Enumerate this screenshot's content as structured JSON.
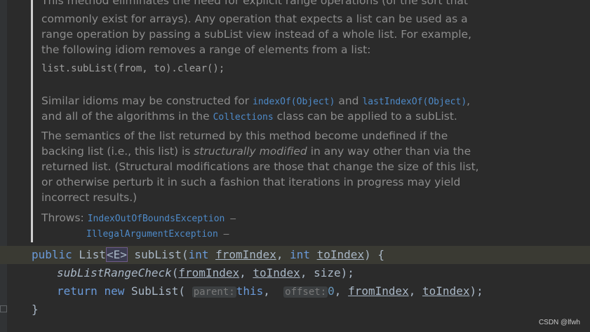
{
  "doc": {
    "line0": "This method eliminates the need for explicit range operations (of the sort that",
    "line1": "commonly exist for arrays). Any operation that expects a list can be used as a",
    "line2": "range operation by passing a subList view instead of a whole list. For example,",
    "line3": "the following idiom removes a range of elements from a list:",
    "code_example": "list.subList(from, to).clear();",
    "p2_a": "Similar idioms may be constructed for ",
    "p2_link1": "indexOf(Object)",
    "p2_b": " and ",
    "p2_link2": "lastIndexOf(Object)",
    "p2_c": ",",
    "p2_line2_a": "and all of the algorithms in the ",
    "p2_link3": "Collections",
    "p2_line2_b": " class can be applied to a subList.",
    "p3_line1": "The semantics of the list returned by this method become undefined if the",
    "p3_line2_a": "backing list (i.e., this list) is ",
    "p3_line2_em": "structurally modified",
    "p3_line2_b": " in any way other than via the",
    "p3_line3": "returned list. (Structural modifications are those that change the size of this list,",
    "p3_line4": "or otherwise perturb it in such a fashion that iterations in progress may yield",
    "p3_line5": "incorrect results.)",
    "throws_label": "Throws: ",
    "throws1": "IndexOutOfBoundsException",
    "throws1_dash": " –",
    "throws2": "IllegalArgumentException",
    "throws2_dash": " –"
  },
  "code": {
    "l1_public": "public",
    "l1_type": " List",
    "l1_generic": "<E>",
    "l1_method": " subList",
    "l1_open": "(",
    "l1_int1": "int",
    "l1_p1": "fromIndex",
    "l1_comma": ", ",
    "l1_int2": "int",
    "l1_p2": "toIndex",
    "l1_close": ") {",
    "l2_call": "subListRangeCheck",
    "l2_open": "(",
    "l2_a1": "fromIndex",
    "l2_c1": ", ",
    "l2_a2": "toIndex",
    "l2_c2": ", ",
    "l2_a3": "size",
    "l2_close": ");",
    "l3_return": "return",
    "l3_new": "new",
    "l3_type": "SubList(",
    "l3_hint1": "parent:",
    "l3_this": "this",
    "l3_c1": ", ",
    "l3_hint2": "offset:",
    "l3_zero": "0",
    "l3_c2": ", ",
    "l3_a1": "fromIndex",
    "l3_c3": ", ",
    "l3_a2": "toIndex",
    "l3_close": ");",
    "l4_brace": "}"
  },
  "watermark": "CSDN @lfwh"
}
